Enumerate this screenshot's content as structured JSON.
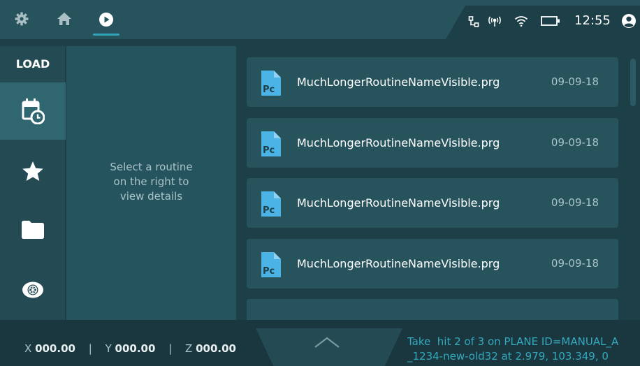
{
  "topbar": {
    "icons": [
      "gear-icon",
      "home-icon",
      "play-icon"
    ],
    "status_icons": [
      "network-icon",
      "antenna-icon",
      "wifi-icon",
      "battery-icon",
      "user-icon"
    ],
    "time": "12:55"
  },
  "sidebar": {
    "title": "LOAD",
    "items": [
      {
        "icon": "recent-calendar-icon",
        "active": true
      },
      {
        "icon": "star-icon",
        "active": false
      },
      {
        "icon": "folder-icon",
        "active": false
      },
      {
        "icon": "eye-icon",
        "active": false
      }
    ]
  },
  "detail": {
    "message_line1": "Select a routine",
    "message_line2": "on the right to",
    "message_line3": "view details"
  },
  "routines": [
    {
      "icon_label": "Pc",
      "name": "MuchLongerRoutineNameVisible.prg",
      "date": "09-09-18"
    },
    {
      "icon_label": "Pc",
      "name": "MuchLongerRoutineNameVisible.prg",
      "date": "09-09-18"
    },
    {
      "icon_label": "Pc",
      "name": "MuchLongerRoutineNameVisible.prg",
      "date": "09-09-18"
    },
    {
      "icon_label": "Pc",
      "name": "MuchLongerRoutineNameVisible.prg",
      "date": "09-09-18"
    }
  ],
  "bottombar": {
    "x_label": "X",
    "x_value": "000.00",
    "y_label": "Y",
    "y_value": "000.00",
    "z_label": "Z",
    "z_value": "000.00",
    "separator": "|",
    "status_line1": "Take  hit 2 of 3 on PLANE ID=MANUAL_A",
    "status_line2": "_1234-new-old32 at 2.979, 103.349, 0"
  },
  "colors": {
    "background": "#1d3f48",
    "panel": "#27535d",
    "active": "#2f6670",
    "accent": "#2fa3b8",
    "file_icon": "#4cb3e6"
  }
}
